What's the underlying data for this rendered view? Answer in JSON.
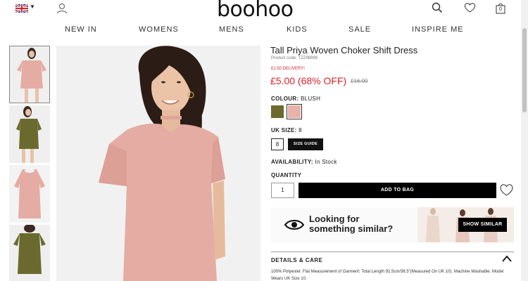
{
  "header": {
    "logo": "boohoo",
    "flag_icon": "uk-flag-icon",
    "icons": [
      "account-icon",
      "search-icon",
      "heart-icon",
      "bag-icon"
    ],
    "bag_count": "0"
  },
  "nav": {
    "items": [
      "NEW IN",
      "WOMENS",
      "MENS",
      "KIDS",
      "SALE",
      "INSPIRE ME"
    ]
  },
  "product": {
    "title": "Tall Priya Woven Choker Shift Dress",
    "product_code": "Product code: TZZ98999",
    "delivery": "£1.50 DELIVERY!",
    "price": "£5.00 (68% OFF)",
    "was_price": "£16.00",
    "colour_label": "COLOUR:",
    "colour_value": "BLUSH",
    "swatches": [
      {
        "name": "khaki",
        "color": "#6e6a2f"
      },
      {
        "name": "blush",
        "color": "#e7b3ab"
      }
    ],
    "size_label": "UK SIZE:",
    "size_value": "8",
    "size_option": "8",
    "size_guide": "SIZE GUIDE",
    "availability_label": "AVAILABILITY:",
    "availability_value": "In Stock",
    "quantity_label": "QUANTITY",
    "quantity_value": "1",
    "add_to_bag": "ADD TO BAG"
  },
  "similar": {
    "line1": "Looking for",
    "line2": "something similar?",
    "button": "SHOW SIMILAR"
  },
  "details": {
    "heading": "DETAILS & CARE",
    "text": "100% Polyester. Flat Measurement of Garment: Total Length 92.5cm/36.5\"(Measured On UK 10). Machine Washable. Model Wears UK Size 10."
  },
  "colors": {
    "sale_red": "#d8232a",
    "dress_blush": "#e4aca2",
    "dress_khaki": "#6b6a2e"
  }
}
